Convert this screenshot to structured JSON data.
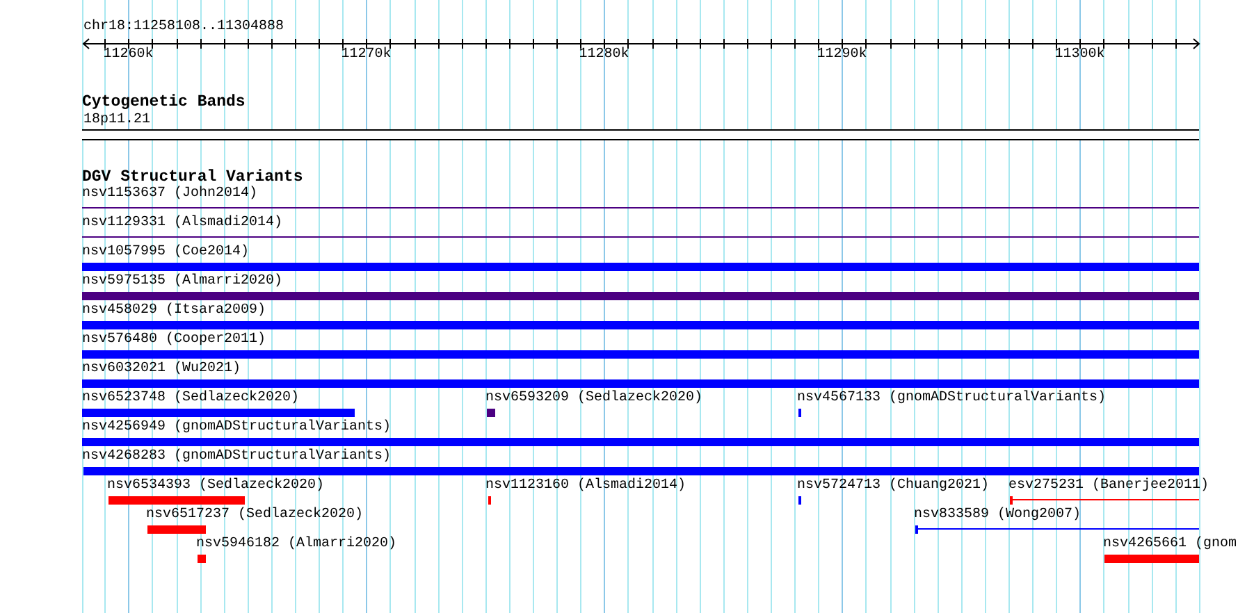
{
  "location": "chr18:11258108..11304888",
  "ruler": {
    "ticks": [
      "11260k",
      "11270k",
      "11280k",
      "11290k",
      "11300k"
    ]
  },
  "cytobands": {
    "title": "Cytogenetic Bands",
    "bands": [
      {
        "label": "18p11.21"
      }
    ]
  },
  "variants": {
    "title": "DGV Structural Variants",
    "features": [
      {
        "label": "nsv1153637 (John2014)",
        "kind": "line",
        "color": "#4b0082"
      },
      {
        "label": "nsv1129331 (Alsmadi2014)",
        "kind": "line",
        "color": "#4b0082"
      },
      {
        "label": "nsv1057995 (Coe2014)",
        "kind": "bar",
        "color": "#0000ff"
      },
      {
        "label": "nsv5975135 (Almarri2020)",
        "kind": "bar",
        "color": "#4b0082"
      },
      {
        "label": "nsv458029 (Itsara2009)",
        "kind": "bar",
        "color": "#0000ff"
      },
      {
        "label": "nsv576480 (Cooper2011)",
        "kind": "bar",
        "color": "#0000ff"
      },
      {
        "label": "nsv6032021 (Wu2021)",
        "kind": "bar",
        "color": "#0000ff"
      },
      {
        "label": "nsv6523748 (Sedlazeck2020)",
        "kind": "bar",
        "color": "#0000ff"
      },
      {
        "label": "nsv6593209 (Sedlazeck2020)",
        "kind": "bar",
        "color": "#4b0082"
      },
      {
        "label": "nsv4567133 (gnomADStructuralVariants)",
        "kind": "bar",
        "color": "#0000ff"
      },
      {
        "label": "nsv4256949 (gnomADStructuralVariants)",
        "kind": "bar",
        "color": "#0000ff"
      },
      {
        "label": "nsv4268283 (gnomADStructuralVariants)",
        "kind": "bar",
        "color": "#0000ff"
      },
      {
        "label": "nsv6534393 (Sedlazeck2020)",
        "kind": "bar",
        "color": "#ff0000"
      },
      {
        "label": "nsv1123160 (Alsmadi2014)",
        "kind": "bar",
        "color": "#ff0000"
      },
      {
        "label": "nsv5724713 (Chuang2021)",
        "kind": "bar",
        "color": "#0000ff"
      },
      {
        "label": "esv275231 (Banerjee2011)",
        "kind": "capped-line",
        "color": "#ff0000"
      },
      {
        "label": "nsv6517237 (Sedlazeck2020)",
        "kind": "bar",
        "color": "#ff0000"
      },
      {
        "label": "nsv833589 (Wong2007)",
        "kind": "capped-line",
        "color": "#0000ff"
      },
      {
        "label": "nsv5946182 (Almarri2020)",
        "kind": "bar",
        "color": "#ff0000"
      },
      {
        "label": "nsv4265661 (gnom",
        "kind": "bar",
        "color": "#ff0000"
      }
    ]
  }
}
